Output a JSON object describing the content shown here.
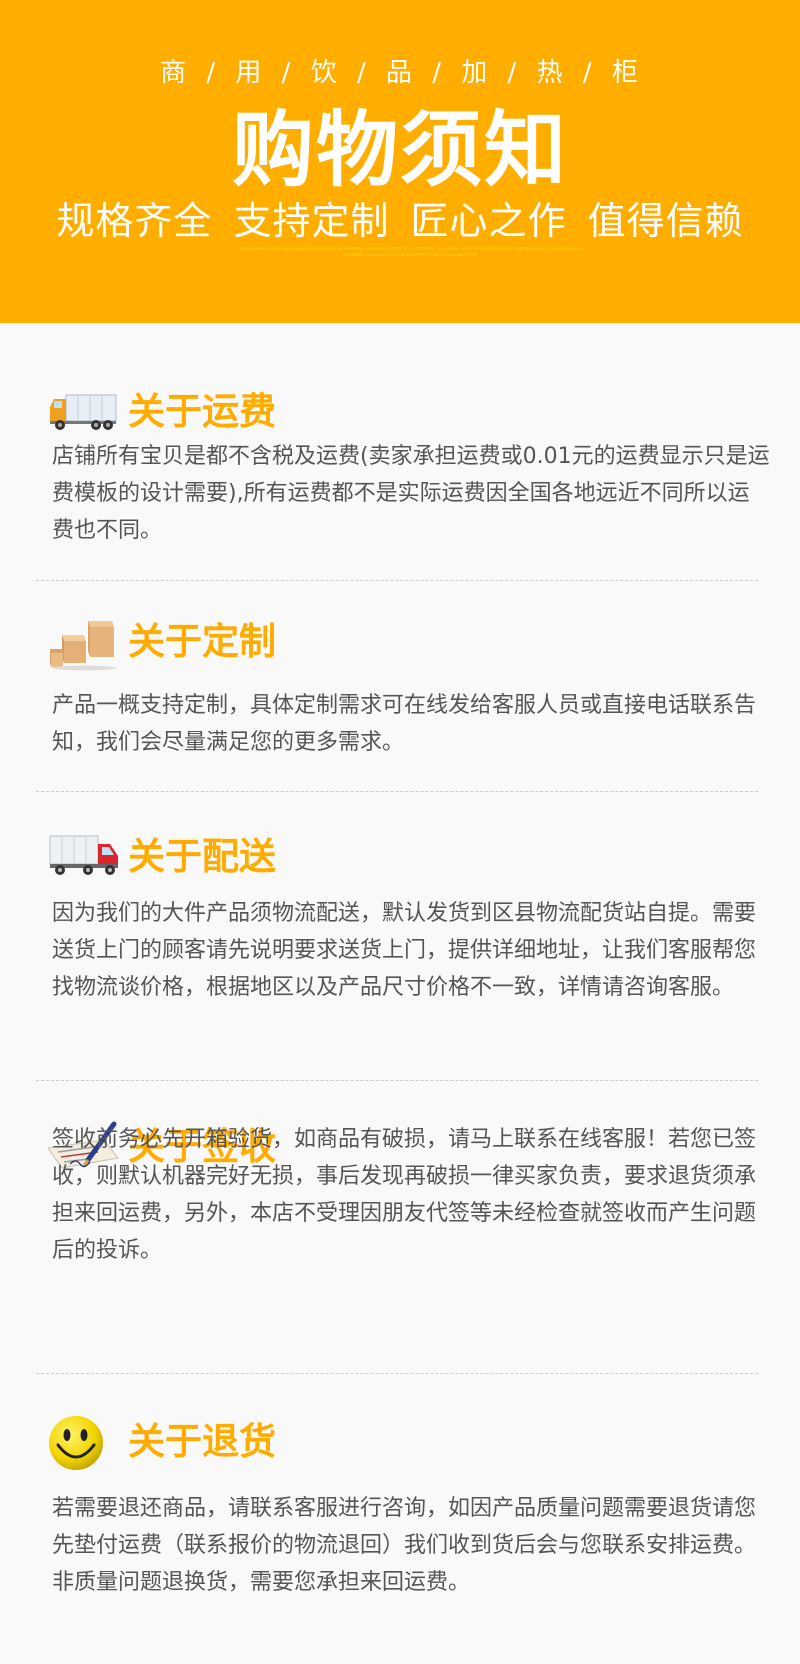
{
  "header": {
    "subtitle": "商 / 用 / 饮 / 品 / 加 / 热 / 柜",
    "title": "购物须知",
    "slogan": "规格齐全 支持定制  匠心之作 值得信赖",
    "fine_print": "ALTHOUGH YOU DON'T HAVE IN DISTRESS/NEEDS, OFTEN FROM THE DATA RATHER OF LIFE/SPEND.... YOU DON'T HAVE IN DISTRESS/NEEDS. OMIT BECAUSE OF BAD LUCK AND DISPOSED OF BAD LUCK AH BE DISPOSED OF BAD LUCK AND DISPO"
  },
  "sections": [
    {
      "icon": "truck-icon",
      "title": "关于运费",
      "body": "店铺所有宝贝是都不含税及运费(卖家承担运费或0.01元的运费显示只是运费模板的设计需要),所有运费都不是实际运费因全国各地远近不同所以运费也不同。"
    },
    {
      "icon": "boxes-icon",
      "title": "关于定制",
      "body": "产品一概支持定制，具体定制需求可在线发给客服人员或直接电话联系告知，我们会尽量满足您的更多需求。"
    },
    {
      "icon": "delivery-truck-icon",
      "title": "关于配送",
      "body": "因为我们的大件产品须物流配送，默认发货到区县物流配货站自提。需要送货上门的顾客请先说明要求送货上门，提供详细地址，让我们客服帮您找物流谈价格，根据地区以及产品尺寸价格不一致，详情请咨询客服。"
    },
    {
      "icon": "signature-pen-icon",
      "title": "关于签收",
      "body": "签收前务必先开箱验货，如商品有破损，请马上联系在线客服！若您已签收，则默认机器完好无损，事后发现再破损一律买家负责，要求退货须承担来回运费，另外，本店不受理因朋友代签等未经检查就签收而产生问题后的投诉。"
    },
    {
      "icon": "smiley-icon",
      "title": "关于退货",
      "body": "若需要退还商品，请联系客服进行咨询，如因产品质量问题需要退货请您先垫付运费（联系报价的物流退回）我们收到货后会与您联系安排运费。非质量问题退换货，需要您承担来回运费。"
    }
  ],
  "colors": {
    "banner": "#ffae00",
    "accent": "#ffab00",
    "text": "#555555"
  }
}
